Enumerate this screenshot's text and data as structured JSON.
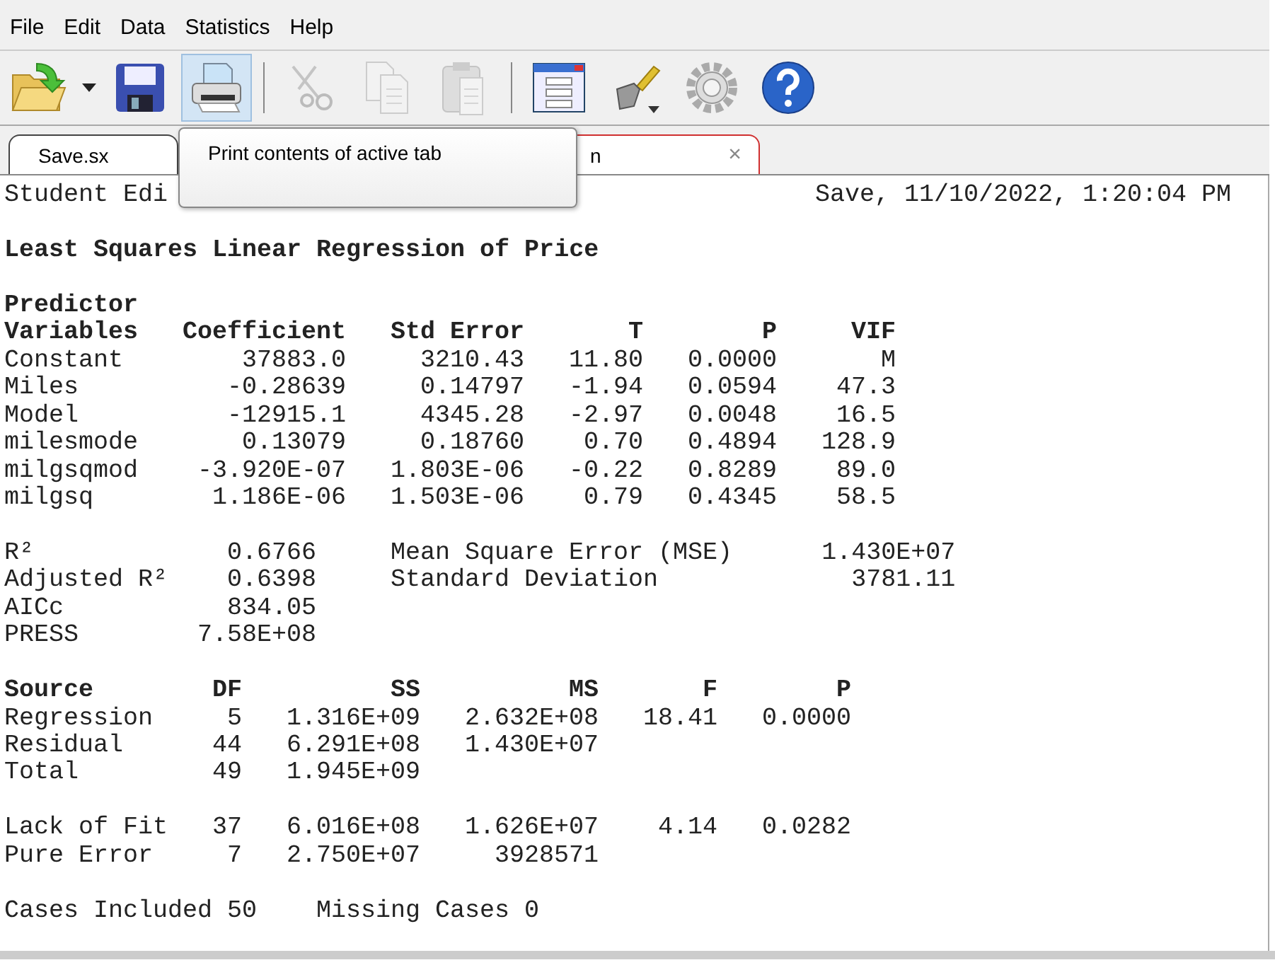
{
  "menu": [
    "File",
    "Edit",
    "Data",
    "Statistics",
    "Help"
  ],
  "toolbar": [
    {
      "kind": "open",
      "highlighted": false,
      "disabled": false
    },
    {
      "kind": "dropdown"
    },
    {
      "kind": "save",
      "highlighted": false,
      "disabled": false
    },
    {
      "kind": "print",
      "highlighted": true,
      "disabled": false
    },
    {
      "kind": "separator"
    },
    {
      "kind": "cut",
      "highlighted": false,
      "disabled": true
    },
    {
      "kind": "copy",
      "highlighted": false,
      "disabled": true
    },
    {
      "kind": "paste",
      "highlighted": false,
      "disabled": true
    },
    {
      "kind": "separator"
    },
    {
      "kind": "dialog",
      "highlighted": false,
      "disabled": false
    },
    {
      "kind": "shovel",
      "highlighted": false,
      "disabled": false
    },
    {
      "kind": "settings",
      "highlighted": false,
      "disabled": false
    },
    {
      "kind": "help",
      "highlighted": false,
      "disabled": false
    }
  ],
  "tabs": [
    {
      "label": "Save.sx",
      "selected": false
    },
    {
      "label": "n",
      "selected": true,
      "close": "×"
    }
  ],
  "tooltip": "Print contents of active tab",
  "output": {
    "header_left": "Student Edi",
    "header_right": "Save, 11/10/2022, 1:20:04 PM",
    "title": "Least Squares Linear Regression of Price",
    "coefficients": {
      "header_top": "Predictor",
      "columns": [
        "Variables",
        "Coefficient",
        "Std Error",
        "T",
        "P",
        "VIF"
      ],
      "rows": [
        [
          "Constant",
          "37883.0",
          "3210.43",
          "11.80",
          "0.0000",
          "M"
        ],
        [
          "Miles",
          "-0.28639",
          "0.14797",
          "-1.94",
          "0.0594",
          "47.3"
        ],
        [
          "Model",
          "-12915.1",
          "4345.28",
          "-2.97",
          "0.0048",
          "16.5"
        ],
        [
          "milesmode",
          "0.13079",
          "0.18760",
          "0.70",
          "0.4894",
          "128.9"
        ],
        [
          "milgsqmod",
          "-3.920E-07",
          "1.803E-06",
          "-0.22",
          "0.8289",
          "89.0"
        ],
        [
          "milgsq",
          "1.186E-06",
          "1.503E-06",
          "0.79",
          "0.4345",
          "58.5"
        ]
      ]
    },
    "fit_stats": [
      [
        "R²",
        "0.6766",
        "Mean Square Error (MSE)",
        "1.430E+07"
      ],
      [
        "Adjusted R²",
        "0.6398",
        "Standard Deviation",
        "3781.11"
      ],
      [
        "AICc",
        "834.05"
      ],
      [
        "PRESS",
        "7.58E+08"
      ]
    ],
    "anova": {
      "columns": [
        "Source",
        "DF",
        "SS",
        "MS",
        "F",
        "P"
      ],
      "rows": [
        [
          "Regression",
          "5",
          "1.316E+09",
          "2.632E+08",
          "18.41",
          "0.0000"
        ],
        [
          "Residual",
          "44",
          "6.291E+08",
          "1.430E+07"
        ],
        [
          "Total",
          "49",
          "1.945E+09"
        ]
      ],
      "lack_of_fit_rows": [
        [
          "Lack of Fit",
          "37",
          "6.016E+08",
          "1.626E+07",
          "4.14",
          "0.0282"
        ],
        [
          "Pure Error",
          "7",
          "2.750E+07",
          "3928571"
        ]
      ]
    },
    "cases": [
      "Cases Included 50",
      "Missing Cases 0"
    ]
  }
}
